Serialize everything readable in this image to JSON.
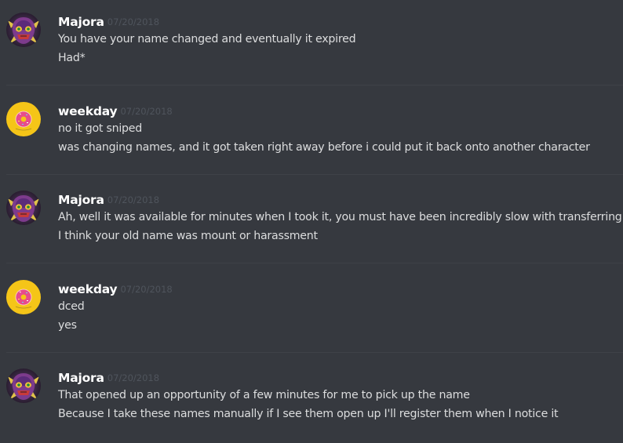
{
  "messages": [
    {
      "author": "Majora",
      "timestamp": "07/20/2018",
      "avatar_icon": "skull-mask-avatar-icon",
      "lines": [
        "You have your name changed and eventually it expired",
        "Had*"
      ]
    },
    {
      "author": "weekday",
      "timestamp": "07/20/2018",
      "avatar_icon": "donut-avatar-icon",
      "lines": [
        "no it got sniped",
        "was changing names, and it got taken right away before i could put it back onto another character"
      ]
    },
    {
      "author": "Majora",
      "timestamp": "07/20/2018",
      "avatar_icon": "skull-mask-avatar-icon",
      "lines": [
        "Ah, well it was available for minutes when I took it, you must have been incredibly slow with transferring it",
        "I think your old name was mount or harassment"
      ]
    },
    {
      "author": "weekday",
      "timestamp": "07/20/2018",
      "avatar_icon": "donut-avatar-icon",
      "lines": [
        "dced",
        "yes"
      ]
    },
    {
      "author": "Majora",
      "timestamp": "07/20/2018",
      "avatar_icon": "skull-mask-avatar-icon",
      "lines": [
        "That opened up an opportunity of a few minutes for me to pick up the name",
        "Because I take these names manually if I see them open up I'll register them when I notice it"
      ]
    }
  ],
  "colors": {
    "background": "#36393f",
    "username": "#ffffff",
    "timestamp": "#4f545c",
    "message_text": "#dcddde",
    "divider": "#3f4248",
    "donut_avatar_bg": "#f5c518"
  }
}
